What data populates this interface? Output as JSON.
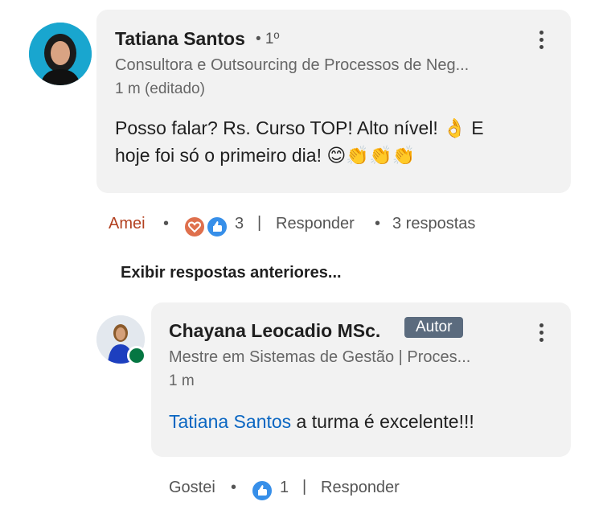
{
  "comment": {
    "author_name": "Tatiana Santos",
    "degree": "• 1º",
    "headline": "Consultora e Outsourcing de Processos de Neg...",
    "time": "1 m (editado)",
    "text_line1": "Posso falar? Rs. Curso TOP! Alto nível! 👌 E",
    "text_line2": "hoje foi só o primeiro dia! 😊👏👏👏",
    "reaction_label": "Amei",
    "reaction_count": "3",
    "reply_label": "Responder",
    "replies_count": "3 respostas",
    "dot": "•",
    "sep": "|"
  },
  "show_previous": "Exibir respostas anteriores...",
  "reply": {
    "author_name": "Chayana Leocadio MSc.",
    "author_badge": "Autor",
    "headline": "Mestre em Sistemas de Gestão | Proces...",
    "time": "1 m",
    "mention": "Tatiana Santos",
    "text": " a turma é excelente!!!",
    "reaction_label": "Gostei",
    "reaction_count": "1",
    "reply_label": "Responder",
    "dot": "•",
    "sep": "|"
  },
  "colors": {
    "love_reaction": "#b24020",
    "like_blue": "#378fe9",
    "mention": "#0a66c2",
    "online": "#057642"
  }
}
